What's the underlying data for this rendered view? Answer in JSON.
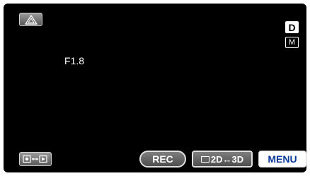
{
  "overlay": {
    "aperture": "F1.8",
    "badge_d": "D",
    "badge_m": "M"
  },
  "buttons": {
    "tilt_icon": "warning-triangle-icon",
    "mode_icon": "camera-playback-switch-icon",
    "rec_label": "REC",
    "toggle_2d3d_label": "2D↔3D",
    "menu_label": "MENU"
  },
  "colors": {
    "background": "#000000",
    "menu_text": "#0a3a9a"
  }
}
